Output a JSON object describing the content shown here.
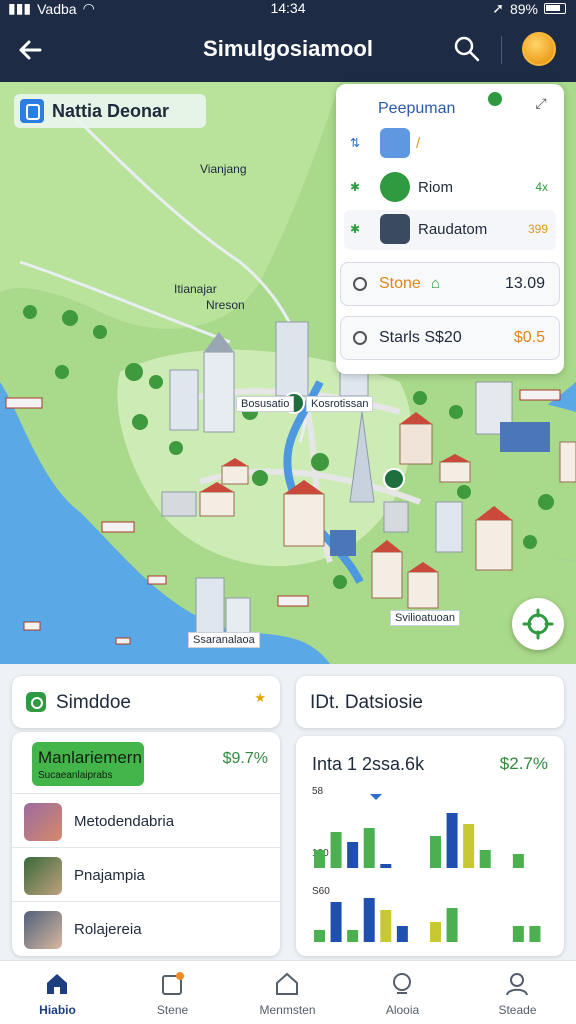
{
  "status_bar": {
    "carrier": "Vadba",
    "time": "14:34",
    "battery": "89%"
  },
  "header": {
    "title": "Simulgosiamool"
  },
  "map": {
    "location_chip": "Nattia Deonar",
    "labels": {
      "top": "Vianjang",
      "mid_1": "Itianajar",
      "mid_2": "Nreson"
    },
    "tags": [
      "Bosusatio",
      "Kosrotissan",
      "Ssaranalaoa",
      "Svilioatuoan"
    ]
  },
  "panel": {
    "title": "Peepuman",
    "rows": [
      {
        "label": "Riom",
        "value": "4x"
      },
      {
        "label": "Raudatom",
        "value": "399"
      }
    ],
    "stone": {
      "label": "Stone",
      "value": "13.09"
    },
    "stats": {
      "label": "Starls S$20",
      "value": "$0.5"
    }
  },
  "left_card": {
    "title": "Simddoe",
    "highlight": {
      "name": "Manlariemern",
      "sub": "Sucaeanlaiprabs",
      "value": "$9.7%"
    },
    "items": [
      {
        "label": "Metodendabria"
      },
      {
        "label": "Pnajampia"
      },
      {
        "label": "Rolajereia"
      }
    ]
  },
  "right_card": {
    "title": "IDt. Datsiosie",
    "chart_title": "Inta 1 2ssa.6k",
    "value": "$2.7%"
  },
  "chart_data": {
    "type": "bar",
    "ytick_labels": [
      "58",
      "100",
      "S60"
    ],
    "series": [
      {
        "color": "#4caf50",
        "values": [
          18,
          36,
          0,
          40,
          0,
          0,
          0,
          32,
          0,
          0,
          18,
          0,
          14,
          0
        ]
      },
      {
        "color": "#1f4fb0",
        "values": [
          0,
          0,
          26,
          0,
          4,
          0,
          0,
          0,
          55,
          0,
          0,
          0,
          0,
          0
        ]
      },
      {
        "color": "#c8c832",
        "values": [
          0,
          0,
          0,
          0,
          0,
          0,
          0,
          0,
          0,
          44,
          0,
          0,
          0,
          0
        ]
      }
    ],
    "series_bottom": [
      {
        "color": "#4caf50",
        "values": [
          12,
          0,
          12,
          0,
          0,
          0,
          0,
          0,
          34,
          0,
          0,
          0,
          16,
          16
        ]
      },
      {
        "color": "#1f4fb0",
        "values": [
          0,
          40,
          0,
          44,
          0,
          16,
          0,
          0,
          0,
          0,
          0,
          0,
          0,
          0
        ]
      },
      {
        "color": "#c8c832",
        "values": [
          0,
          0,
          0,
          0,
          32,
          0,
          0,
          20,
          0,
          0,
          0,
          0,
          0,
          0
        ]
      }
    ]
  },
  "bottom_nav": {
    "items": [
      {
        "label": "Hiabio",
        "icon": "home-icon",
        "active": true
      },
      {
        "label": "Stene",
        "icon": "store-icon",
        "active": false
      },
      {
        "label": "Menmsten",
        "icon": "house-icon",
        "active": false
      },
      {
        "label": "Alooia",
        "icon": "search-icon",
        "active": false
      },
      {
        "label": "Steade",
        "icon": "profile-icon",
        "active": false
      }
    ]
  }
}
